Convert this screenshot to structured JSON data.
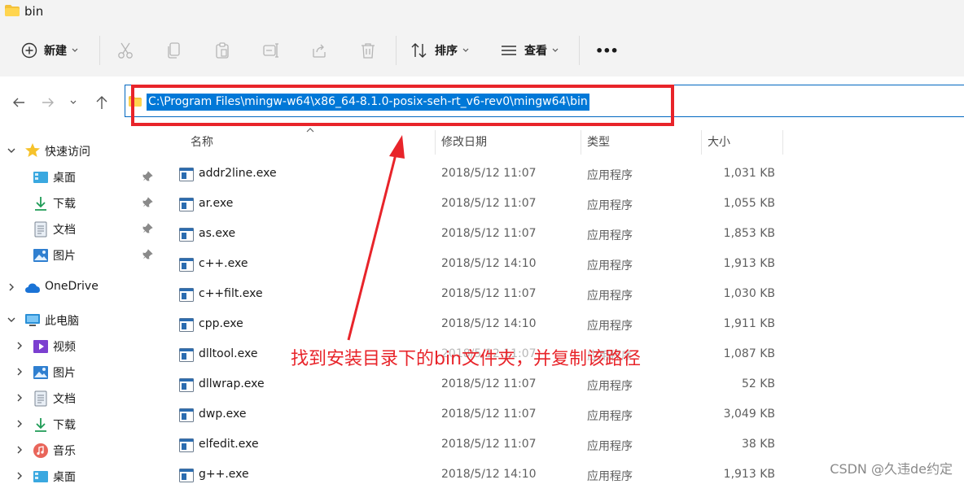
{
  "window": {
    "title": "bin"
  },
  "toolbar": {
    "new_label": "新建",
    "sort_label": "排序",
    "view_label": "查看",
    "more_label": "•••"
  },
  "address": {
    "path": "C:\\Program Files\\mingw-w64\\x86_64-8.1.0-posix-seh-rt_v6-rev0\\mingw64\\bin"
  },
  "sidebar": {
    "quick_access": "快速访问",
    "quick_items": [
      "桌面",
      "下载",
      "文档",
      "图片"
    ],
    "onedrive": "OneDrive",
    "this_pc": "此电脑",
    "pc_items": [
      "视频",
      "图片",
      "文档",
      "下载",
      "音乐",
      "桌面"
    ]
  },
  "columns": {
    "name": "名称",
    "date": "修改日期",
    "type": "类型",
    "size": "大小"
  },
  "files": [
    {
      "name": "addr2line.exe",
      "date": "2018/5/12 11:07",
      "type": "应用程序",
      "size": "1,031 KB"
    },
    {
      "name": "ar.exe",
      "date": "2018/5/12 11:07",
      "type": "应用程序",
      "size": "1,055 KB"
    },
    {
      "name": "as.exe",
      "date": "2018/5/12 11:07",
      "type": "应用程序",
      "size": "1,853 KB"
    },
    {
      "name": "c++.exe",
      "date": "2018/5/12 14:10",
      "type": "应用程序",
      "size": "1,913 KB"
    },
    {
      "name": "c++filt.exe",
      "date": "2018/5/12 11:07",
      "type": "应用程序",
      "size": "1,030 KB"
    },
    {
      "name": "cpp.exe",
      "date": "2018/5/12 14:10",
      "type": "应用程序",
      "size": "1,911 KB"
    },
    {
      "name": "dlltool.exe",
      "date": "2018/5/12 11:07",
      "type": "应用程序",
      "size": "1,087 KB"
    },
    {
      "name": "dllwrap.exe",
      "date": "2018/5/12 11:07",
      "type": "应用程序",
      "size": "52 KB"
    },
    {
      "name": "dwp.exe",
      "date": "2018/5/12 11:07",
      "type": "应用程序",
      "size": "3,049 KB"
    },
    {
      "name": "elfedit.exe",
      "date": "2018/5/12 11:07",
      "type": "应用程序",
      "size": "38 KB"
    },
    {
      "name": "g++.exe",
      "date": "2018/5/12 14:10",
      "type": "应用程序",
      "size": "1,913 KB"
    }
  ],
  "annotation": {
    "text": "找到安装目录下的bin文件夹，并复制该路径",
    "color": "#e8242a"
  },
  "watermark": "CSDN @久违de约定",
  "colors": {
    "accent": "#0078d7",
    "highlight_border": "#e8242a",
    "folder": "#f3c13a"
  }
}
